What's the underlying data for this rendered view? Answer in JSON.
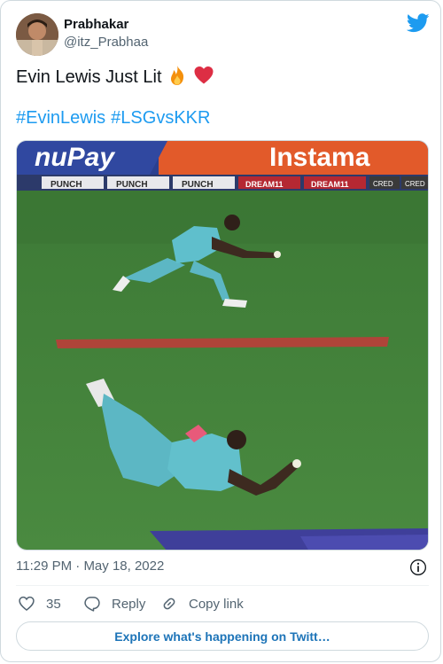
{
  "author": {
    "name": "Prabhakar",
    "handle": "@itz_Prabhaa",
    "avatar_icon": "user-avatar"
  },
  "tweet": {
    "text": "Evin Lewis Just Lit",
    "emojis": [
      "fire-emoji",
      "red-heart-emoji"
    ],
    "hashtags": [
      "#EvinLewis",
      "#LSGvsKKR"
    ]
  },
  "media": {
    "description_icon": "cricket-catch-photo",
    "banner_text_1": "Instama",
    "ads": [
      "PUNCH",
      "PUNCH",
      "PUNCH",
      "DREAM11",
      "DREAM11",
      "CRED",
      "CRED"
    ]
  },
  "meta": {
    "time": "11:29 PM",
    "separator": " · ",
    "date": "May 18, 2022"
  },
  "actions": {
    "likes": "35",
    "reply_label": "Reply",
    "copy_label": "Copy link"
  },
  "explore_label": "Explore what's happening on Twitt…",
  "colors": {
    "accent": "#1d9bf0",
    "like_heart": "#e0245e",
    "grass": "#3f7d3b",
    "muted": "#536471"
  }
}
